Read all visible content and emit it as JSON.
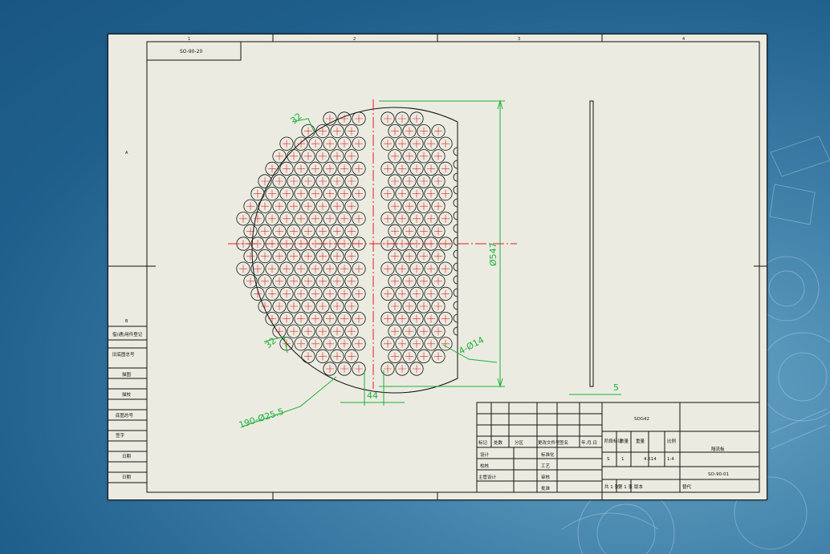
{
  "drawing": {
    "ref_code": "SO-90-20",
    "drawing_no": "SO-90-01",
    "part_code": "SDG42",
    "name_cell": "隔流板",
    "frame_numbers": [
      "1",
      "2",
      "3",
      "4"
    ],
    "frame_letters": [
      "A",
      "B"
    ],
    "dimensions": {
      "hole_pattern": "190-Ø25.5",
      "outer_diameter": "Ø547",
      "pitch_small": "32",
      "pitch_small_2": "32",
      "center_gap": "44",
      "side_holes": "4-Ø14",
      "thickness": "5"
    },
    "left_strip": [
      "借(通)用件登记",
      "旧底图总号",
      "底图总号",
      "签字",
      "日期"
    ],
    "left_strip_short": [
      "描图",
      "描校"
    ],
    "title_block": {
      "header": [
        "标记",
        "处数",
        "分区",
        "更改文件号",
        "签名",
        "年.月.日"
      ],
      "design_rows": [
        {
          "label": "设计",
          "sub": "标准化"
        },
        {
          "label": "校核",
          "sub": "工艺"
        },
        {
          "label": "主管设计",
          "sub": "审核"
        },
        {
          "label": "",
          "sub": "批准"
        }
      ],
      "stage_headers": [
        "阶段标记",
        "数量",
        "重量",
        "比例"
      ],
      "stage_values": [
        "S",
        "1",
        "4.514",
        "1:4"
      ],
      "sheet_info": [
        "共 1 张",
        "第 1 张",
        "版本",
        "替代"
      ]
    }
  },
  "colors": {
    "line": "#111111",
    "centerline": "#e02020",
    "dimension": "#19b33a",
    "paper": "#ecebe1"
  }
}
